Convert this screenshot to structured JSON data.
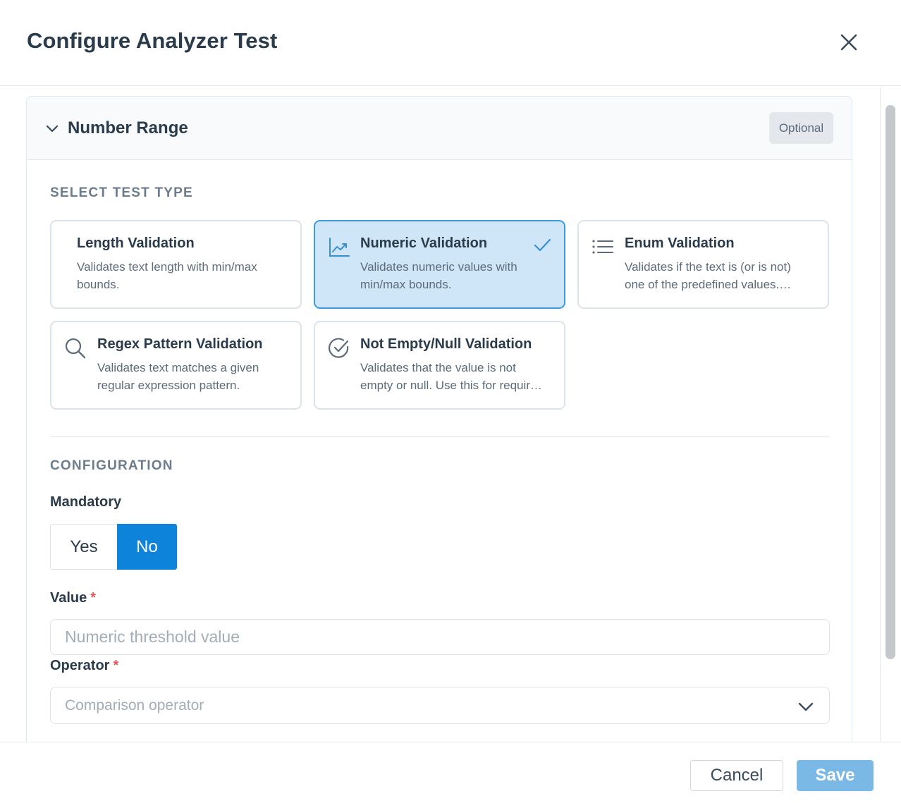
{
  "dialog": {
    "title": "Configure Analyzer Test",
    "close_icon": "close-icon"
  },
  "panel": {
    "title": "Number Range",
    "badge": "Optional",
    "expand_icon": "chevron-down-icon"
  },
  "test_type": {
    "section_label": "SELECT TEST TYPE",
    "selected": "Numeric Validation",
    "cards": [
      {
        "title": "Length Validation",
        "description": "Validates text length with min/max bounds.",
        "icon": "none"
      },
      {
        "title": "Numeric Validation",
        "description": "Validates numeric values with min/max bounds.",
        "icon": "trending-chart-icon",
        "selected": true
      },
      {
        "title": "Enum Validation",
        "description": "Validates if the text is (or is not) one of the predefined values.…",
        "icon": "list-icon"
      },
      {
        "title": "Regex Pattern Validation",
        "description": "Validates text matches a given regular expression pattern.",
        "icon": "search-icon"
      },
      {
        "title": "Not Empty/Null Validation",
        "description": "Validates that the value is not empty or null. Use this for requir…",
        "icon": "check-circle-icon"
      }
    ]
  },
  "configuration": {
    "section_label": "CONFIGURATION",
    "mandatory": {
      "label": "Mandatory",
      "options": [
        "Yes",
        "No"
      ],
      "selected": "No"
    },
    "value": {
      "label": "Value",
      "required_mark": "*",
      "placeholder": "Numeric threshold value",
      "current": ""
    },
    "operator": {
      "label": "Operator",
      "required_mark": "*",
      "placeholder": "Comparison operator"
    }
  },
  "footer": {
    "cancel_label": "Cancel",
    "save_label": "Save"
  },
  "colors": {
    "accent": "#0d84d9",
    "selected_card_bg": "#cfe6f8",
    "selected_card_border": "#3b9be0",
    "save_disabled": "#7ab8e6",
    "required": "#e05a5a"
  }
}
